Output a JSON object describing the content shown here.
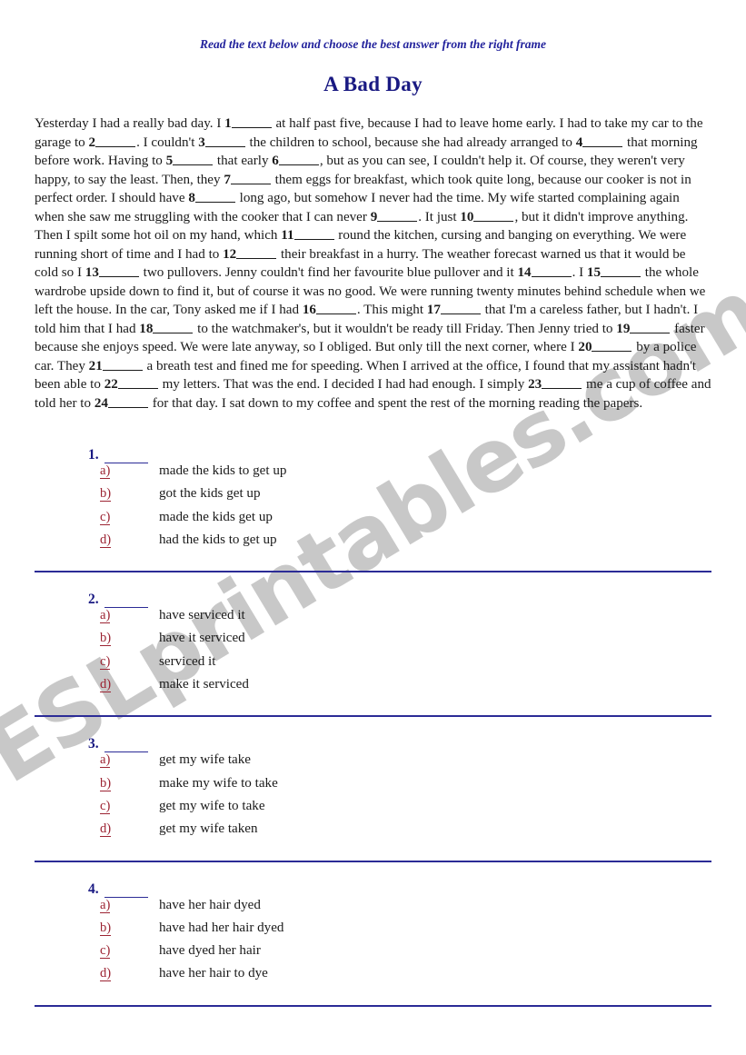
{
  "header": {
    "instruction": "Read the text below and choose the best answer from the right frame",
    "title": "A Bad Day"
  },
  "watermark": {
    "text": "ESLprintables.com",
    "color": "#c8c8c8"
  },
  "colors": {
    "title_navy": "#191982",
    "instruction_blue": "#22229c",
    "rule_navy": "#2b2b96",
    "option_letter_red": "#9c2332",
    "body_text": "#1a1a1a"
  },
  "passage": {
    "segments": [
      {
        "t": "Yesterday I had a really bad day. I "
      },
      {
        "n": "1"
      },
      {
        "t": " at half past five, because I had to leave home early. I had to take my car to the garage to "
      },
      {
        "n": "2"
      },
      {
        "t": ". I couldn't "
      },
      {
        "n": "3"
      },
      {
        "t": " the children to school, because she had already arranged to "
      },
      {
        "n": "4"
      },
      {
        "t": " that morning before work. Having to "
      },
      {
        "n": "5"
      },
      {
        "t": " that early "
      },
      {
        "n": "6"
      },
      {
        "t": ", but as you can see, I couldn't help it. Of course, they weren't very happy, to say the least. Then, they "
      },
      {
        "n": "7"
      },
      {
        "t": " them eggs for breakfast, which took quite long, because our cooker is not in perfect order. I should have "
      },
      {
        "n": "8"
      },
      {
        "t": " long ago, but somehow I never had the time. My wife started complaining again when she saw me struggling with the cooker that I can never "
      },
      {
        "n": "9"
      },
      {
        "t": ". It just "
      },
      {
        "n": "10"
      },
      {
        "t": ", but it didn't improve anything. Then I spilt some hot oil on my hand, which "
      },
      {
        "n": "11"
      },
      {
        "t": " round the kitchen, cursing and banging on everything. We were running short of time and I had to "
      },
      {
        "n": "12"
      },
      {
        "t": " their breakfast in a hurry. The weather forecast warned us that it would be cold so I "
      },
      {
        "n": "13"
      },
      {
        "t": " two pullovers. Jenny couldn't find her favourite blue pullover and it "
      },
      {
        "n": "14"
      },
      {
        "t": ". I "
      },
      {
        "n": "15"
      },
      {
        "t": " the whole wardrobe upside down to find it, but of course it was no good. We were running twenty minutes behind schedule when we left the house. In the car, Tony asked me if I had "
      },
      {
        "n": "16"
      },
      {
        "t": ". This might "
      },
      {
        "n": "17"
      },
      {
        "t": " that I'm a careless father, but I hadn't. I told him that I had "
      },
      {
        "n": "18"
      },
      {
        "t": " to the watchmaker's, but it wouldn't be ready till Friday. Then Jenny tried to "
      },
      {
        "n": "19"
      },
      {
        "t": " faster because she enjoys speed. We were late anyway, so I obliged. But only till the next corner, where I "
      },
      {
        "n": "20"
      },
      {
        "t": " by a police car. They "
      },
      {
        "n": "21"
      },
      {
        "t": " a breath test and fined me for speeding. When I arrived at the office, I found that my assistant hadn't been able to "
      },
      {
        "n": "22"
      },
      {
        "t": " my letters. That was the end. I decided I had had enough. I simply "
      },
      {
        "n": "23"
      },
      {
        "t": " me a cup of coffee and told her to "
      },
      {
        "n": "24"
      },
      {
        "t": " for that day. I sat down to my coffee and spent the rest of the morning reading the papers."
      }
    ]
  },
  "questions": [
    {
      "number": "1.",
      "options": [
        {
          "letter": "a)",
          "text": "made the kids to get up"
        },
        {
          "letter": "b)",
          "text": "got the kids get up"
        },
        {
          "letter": "c)",
          "text": "made the kids get up"
        },
        {
          "letter": "d)",
          "text": "had the kids to get up"
        }
      ]
    },
    {
      "number": "2.",
      "options": [
        {
          "letter": "a)",
          "text": "have serviced it"
        },
        {
          "letter": "b)",
          "text": "have it serviced"
        },
        {
          "letter": "c)",
          "text": "serviced it"
        },
        {
          "letter": "d)",
          "text": "make it serviced"
        }
      ]
    },
    {
      "number": "3.",
      "options": [
        {
          "letter": "a)",
          "text": "get my wife take"
        },
        {
          "letter": "b)",
          "text": "make my wife to take"
        },
        {
          "letter": "c)",
          "text": "get my wife to take"
        },
        {
          "letter": "d)",
          "text": "get my wife taken"
        }
      ]
    },
    {
      "number": "4.",
      "options": [
        {
          "letter": "a)",
          "text": "have her hair dyed"
        },
        {
          "letter": "b)",
          "text": "have had her hair dyed"
        },
        {
          "letter": "c)",
          "text": "have dyed her hair"
        },
        {
          "letter": "d)",
          "text": "have her hair to dye"
        }
      ]
    }
  ]
}
